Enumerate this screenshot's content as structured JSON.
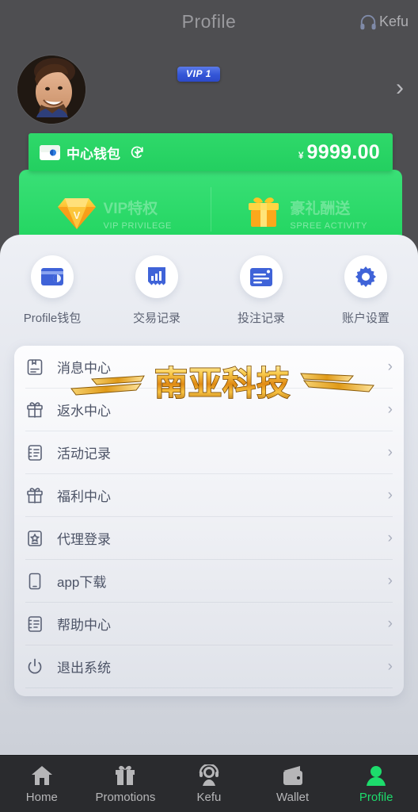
{
  "theme": {
    "accent_green": "#23cf60",
    "panel_green": "#3ae077",
    "nav_active_green": "#1ddc6c",
    "icon_blue": "#3f63d8",
    "vip_badge_blue": "#3355d6",
    "gold": "#f2a718",
    "header_bg": "#4e4e51",
    "nav_bg": "#2a2b2e"
  },
  "header": {
    "title": "Profile",
    "kefu_label": "Kefu",
    "kefu_icon": "headset-icon",
    "vip_badge": "VIP 1",
    "chevron": "›",
    "avatar_icon": "user-photo-avatar"
  },
  "wallet": {
    "icon": "wallet-icon",
    "name": "中心钱包",
    "refresh_icon": "refresh-icon",
    "currency": "¥",
    "balance": "9999.00"
  },
  "promo_panels": [
    {
      "icon": "diamond-icon",
      "title_cn": "VIP特权",
      "title_en": "VIP PRIVILEGE"
    },
    {
      "icon": "gift-box-icon",
      "title_cn": "豪礼酬送",
      "title_en": "SPREE ACTIVITY"
    }
  ],
  "quick_actions": [
    {
      "icon": "wallet-card-icon",
      "label": "Profile钱包"
    },
    {
      "icon": "bar-chart-icon",
      "label": "交易记录"
    },
    {
      "icon": "document-icon",
      "label": "投注记录"
    },
    {
      "icon": "gear-icon",
      "label": "账户设置"
    }
  ],
  "menu": {
    "arrow": "›",
    "items": [
      {
        "icon": "message-box-icon",
        "label": "消息中心"
      },
      {
        "icon": "gift-icon",
        "label": "返水中心"
      },
      {
        "icon": "notebook-icon",
        "label": "活动记录"
      },
      {
        "icon": "gift-icon",
        "label": "福利中心"
      },
      {
        "icon": "badge-star-icon",
        "label": "代理登录"
      },
      {
        "icon": "phone-icon",
        "label": "app下载"
      },
      {
        "icon": "notebook-icon",
        "label": "帮助中心"
      },
      {
        "icon": "power-icon",
        "label": "退出系统"
      }
    ]
  },
  "watermark": {
    "text": "南亚科技"
  },
  "bottom_nav": {
    "items": [
      {
        "icon": "home-icon",
        "label": "Home",
        "active": false
      },
      {
        "icon": "gift-nav-icon",
        "label": "Promotions",
        "active": false
      },
      {
        "icon": "headset-nav-icon",
        "label": "Kefu",
        "active": false
      },
      {
        "icon": "wallet-nav-icon",
        "label": "Wallet",
        "active": false
      },
      {
        "icon": "person-icon",
        "label": "Profile",
        "active": true
      }
    ]
  }
}
